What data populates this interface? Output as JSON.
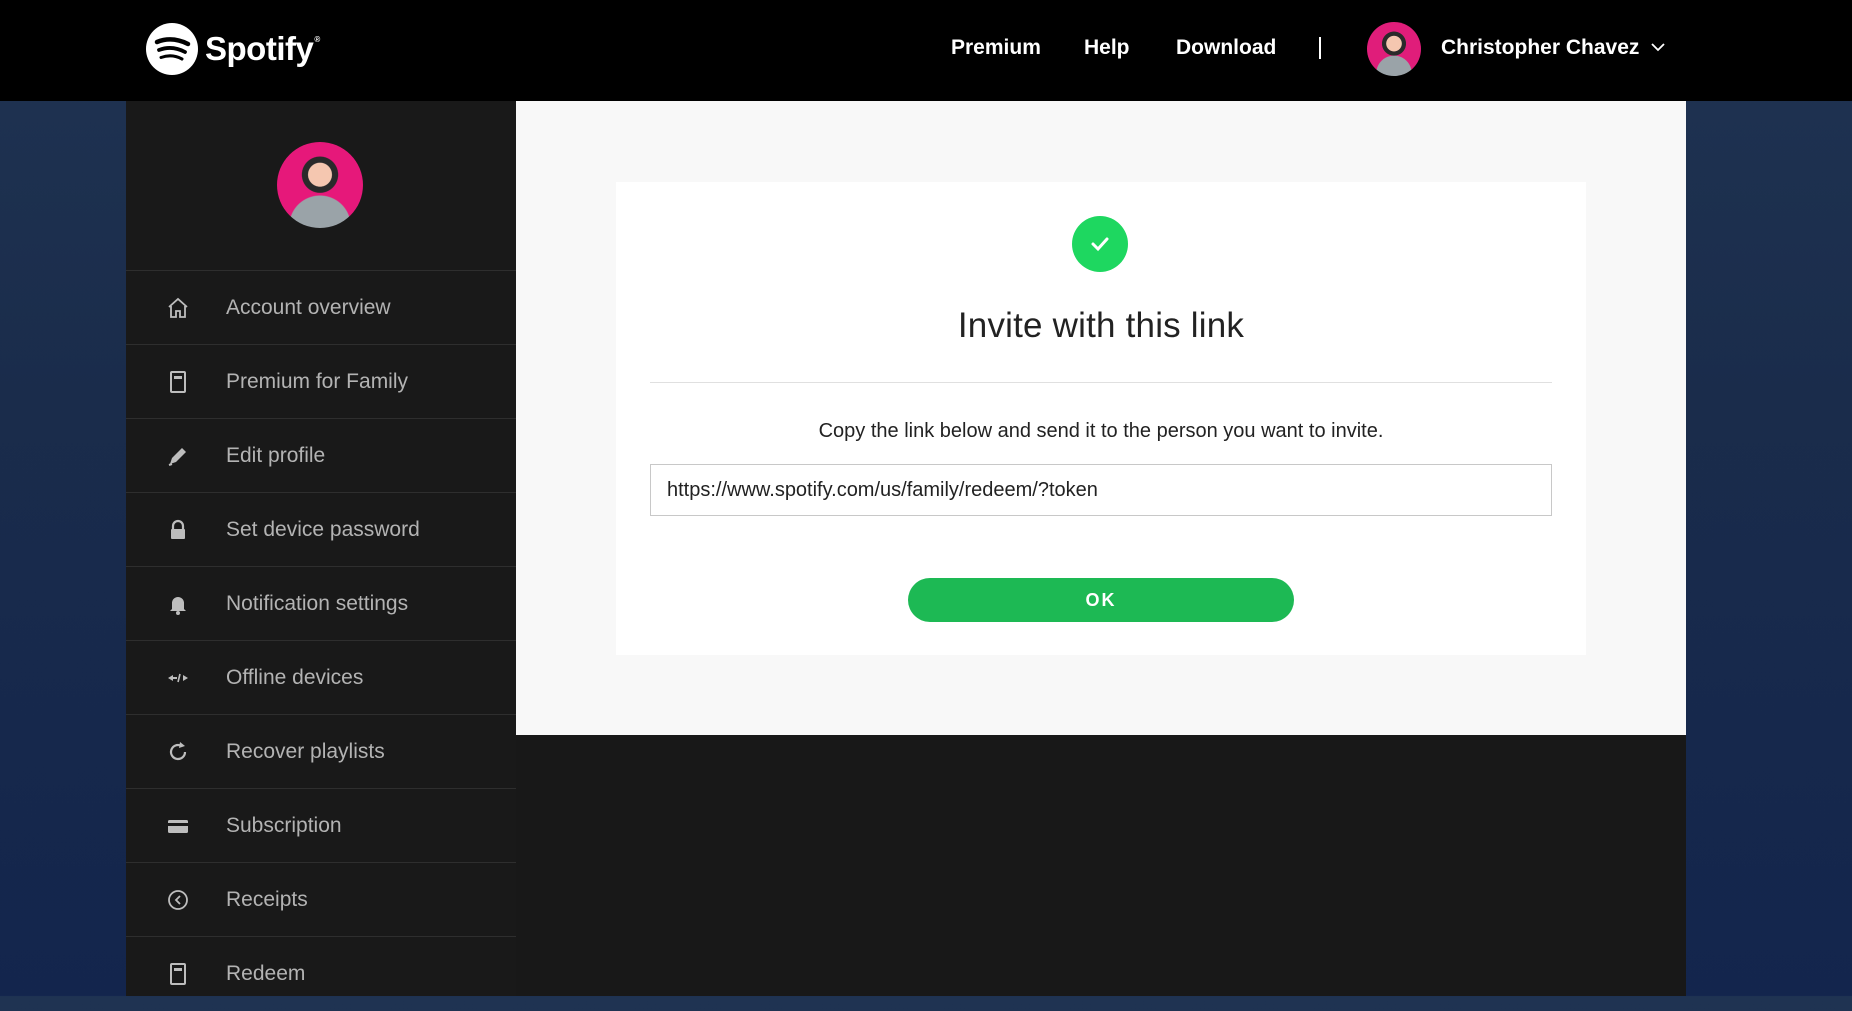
{
  "header": {
    "brand": "Spotify",
    "nav": [
      "Premium",
      "Help",
      "Download"
    ],
    "user_name": "Christopher Chavez"
  },
  "sidebar": {
    "items": [
      {
        "label": "Account overview",
        "icon": "home-icon"
      },
      {
        "label": "Premium for Family",
        "icon": "family-icon"
      },
      {
        "label": "Edit profile",
        "icon": "pencil-icon"
      },
      {
        "label": "Set device password",
        "icon": "lock-icon"
      },
      {
        "label": "Notification settings",
        "icon": "bell-icon"
      },
      {
        "label": "Offline devices",
        "icon": "offline-devices-icon"
      },
      {
        "label": "Recover playlists",
        "icon": "recover-icon"
      },
      {
        "label": "Subscription",
        "icon": "card-icon"
      },
      {
        "label": "Receipts",
        "icon": "receipt-icon"
      },
      {
        "label": "Redeem",
        "icon": "redeem-icon"
      }
    ]
  },
  "invite": {
    "title": "Invite with this link",
    "description": "Copy the link below and send it to the person you want to invite.",
    "link_value": "https://www.spotify.com/us/family/redeem/?token",
    "ok_label": "OK"
  },
  "colors": {
    "accent": "#1db954",
    "check": "#1ed760",
    "sidebar": "#191919",
    "topbar": "#000000"
  }
}
